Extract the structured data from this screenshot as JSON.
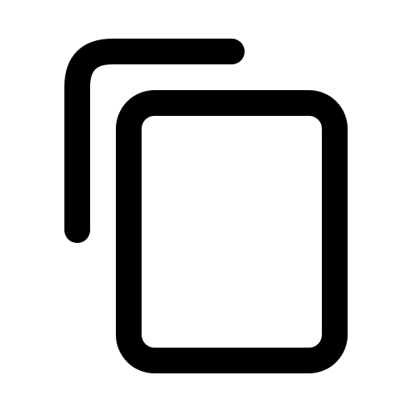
{
  "icon": {
    "name": "copy-icon",
    "stroke_color": "#000000",
    "background_color": "#ffffff"
  }
}
